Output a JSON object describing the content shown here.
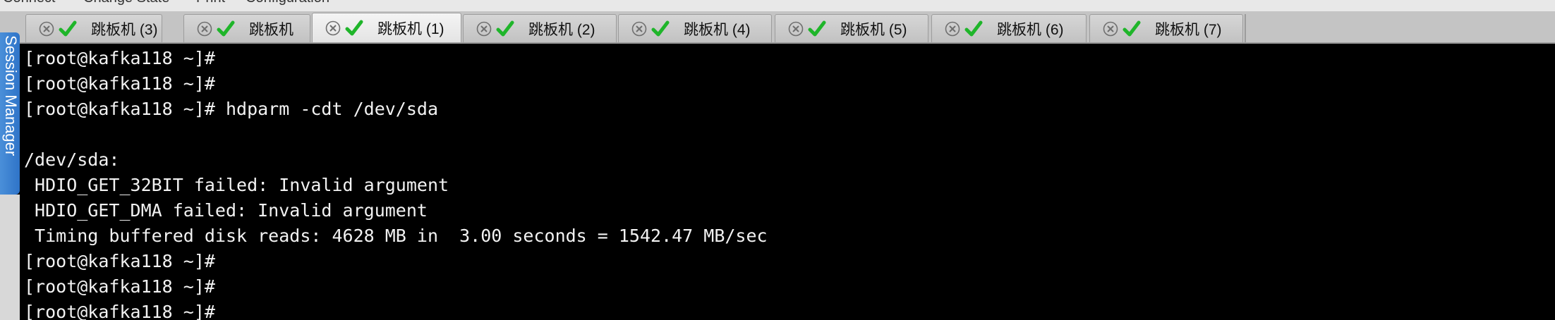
{
  "menu": {
    "items": [
      "Connect",
      "Change State",
      "Print",
      "Configuration"
    ]
  },
  "tabs": [
    {
      "label": "跳板机 (3)",
      "status": "connected",
      "active": false
    },
    {
      "label": "跳板机",
      "status": "connected",
      "active": false
    },
    {
      "label": "跳板机 (1)",
      "status": "connected",
      "active": true
    },
    {
      "label": "跳板机 (2)",
      "status": "connected",
      "active": false
    },
    {
      "label": "跳板机 (4)",
      "status": "connected",
      "active": false
    },
    {
      "label": "跳板机 (5)",
      "status": "connected",
      "active": false
    },
    {
      "label": "跳板机 (6)",
      "status": "connected",
      "active": false
    },
    {
      "label": "跳板机 (7)",
      "status": "connected",
      "active": false
    }
  ],
  "session_manager": {
    "label": "Session Manager"
  },
  "terminal": {
    "lines": [
      "[root@kafka118 ~]#",
      "[root@kafka118 ~]#",
      "[root@kafka118 ~]# hdparm -cdt /dev/sda",
      "",
      "/dev/sda:",
      " HDIO_GET_32BIT failed: Invalid argument",
      " HDIO_GET_DMA failed: Invalid argument",
      " Timing buffered disk reads: 4628 MB in  3.00 seconds = 1542.47 MB/sec",
      "[root@kafka118 ~]#",
      "[root@kafka118 ~]#",
      "[root@kafka118 ~]#"
    ]
  },
  "colors": {
    "terminal_bg": "#000000",
    "terminal_fg": "#f2f2f2",
    "check_green": "#1fb52a",
    "close_gray": "#6f6f6f",
    "session_blue": "#3a80d2"
  },
  "icons": {
    "close": "close-circle-icon",
    "status": "checkmark-icon"
  }
}
